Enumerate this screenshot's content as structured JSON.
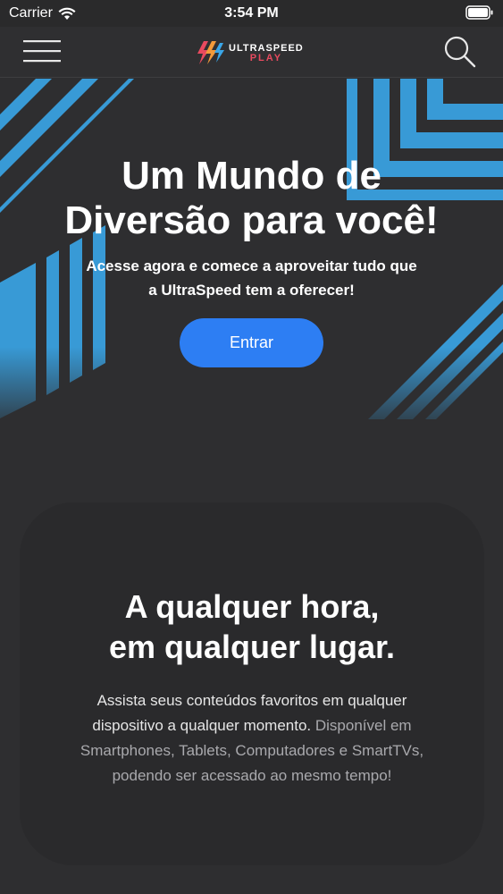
{
  "status_bar": {
    "carrier": "Carrier",
    "time": "3:54 PM"
  },
  "nav": {
    "logo_top": "ULTRASPEED",
    "logo_bottom": "PLAY"
  },
  "hero": {
    "title_line1": "Um Mundo de",
    "title_line2": "Diversão para você!",
    "subtitle_line1": "Acesse agora e comece a aproveitar tudo que",
    "subtitle_line2": "a UltraSpeed tem a oferecer!",
    "enter_label": "Entrar"
  },
  "card": {
    "title_line1": "A qualquer hora,",
    "title_line2": "em qualquer lugar.",
    "text_line1": "Assista seus conteúdos favoritos em qualquer",
    "text_line2a": "dispositivo a qualquer momento.",
    "text_line2b": " Disponível em",
    "text_line3": "Smartphones, Tablets, Computadores e SmartTVs,",
    "text_line4": "podendo ser acessado ao mesmo tempo!"
  },
  "colors": {
    "accent_blue": "#2d7ef3",
    "logo_red": "#e84a5f",
    "stripe_blue": "#3aa6e8"
  },
  "icons": [
    "wifi-icon",
    "battery-icon",
    "menu-icon",
    "logo-bolt-icon",
    "search-icon"
  ]
}
